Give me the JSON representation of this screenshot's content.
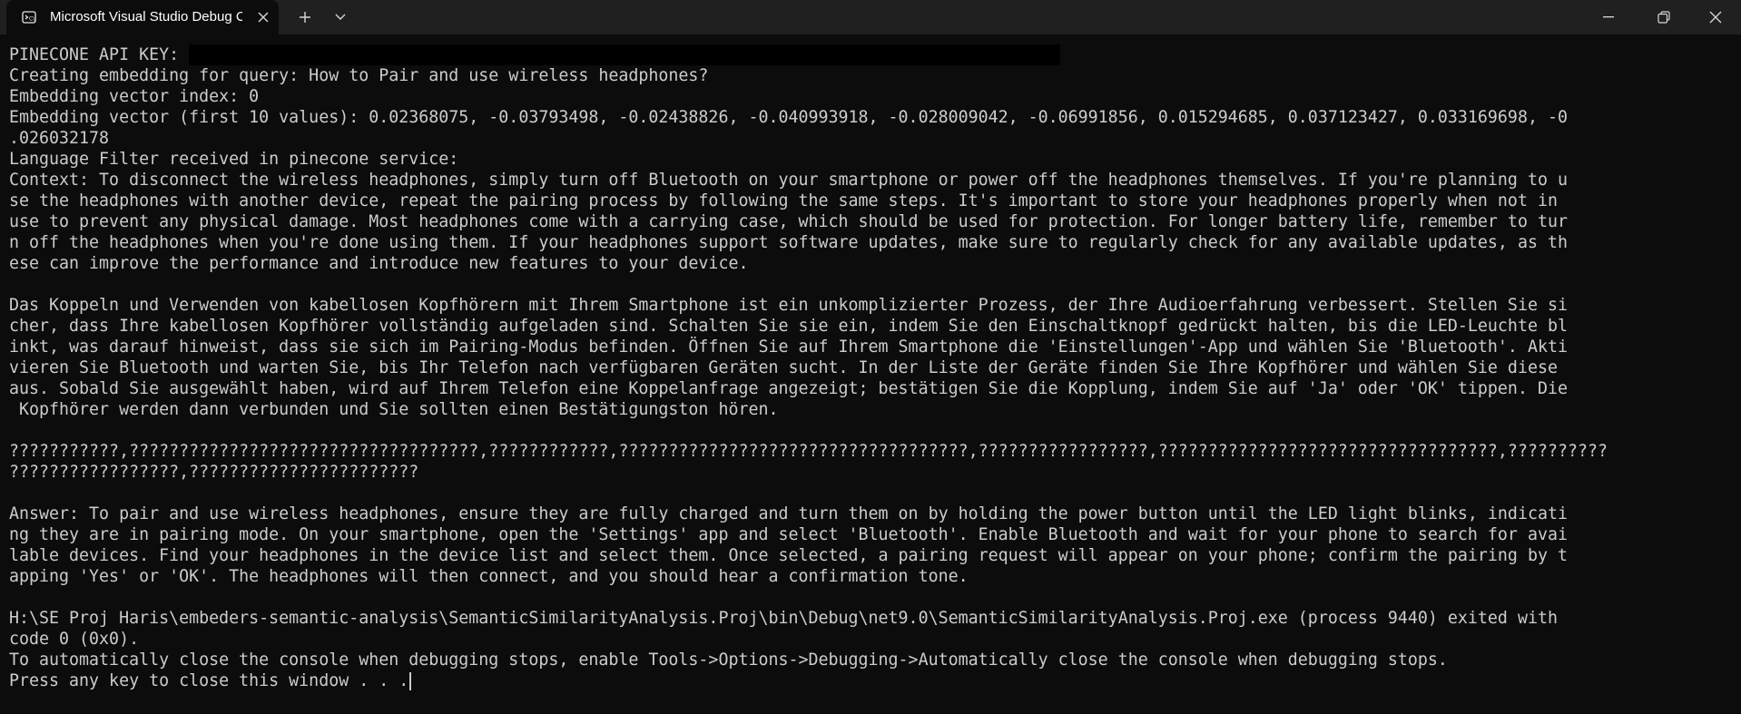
{
  "window": {
    "tab_title": "Microsoft Visual Studio Debug Console",
    "tab_icon": "console-icon",
    "close_tab_icon": "close-icon",
    "new_tab_icon": "plus-icon",
    "dropdown_icon": "chevron-down-icon",
    "minimize_icon": "minimize-icon",
    "maximize_icon": "restore-icon",
    "close_window_icon": "close-icon"
  },
  "console": {
    "lines": {
      "l01": "PINECONE API KEY: ",
      "l02": "Creating embedding for query: How to Pair and use wireless headphones?",
      "l03": "Embedding vector index: 0",
      "l04": "Embedding vector (first 10 values): 0.02368075, -0.03793498, -0.02438826, -0.040993918, -0.028009042, -0.06991856, 0.015294685, 0.037123427, 0.033169698, -0",
      "l05": ".026032178",
      "l06": "Language Filter received in pinecone service:",
      "l07": "Context: To disconnect the wireless headphones, simply turn off Bluetooth on your smartphone or power off the headphones themselves. If you're planning to u",
      "l08": "se the headphones with another device, repeat the pairing process by following the same steps. It's important to store your headphones properly when not in",
      "l09": "use to prevent any physical damage. Most headphones come with a carrying case, which should be used for protection. For longer battery life, remember to tur",
      "l10": "n off the headphones when you're done using them. If your headphones support software updates, make sure to regularly check for any available updates, as th",
      "l11": "ese can improve the performance and introduce new features to your device.",
      "l12": "",
      "l13": "Das Koppeln und Verwenden von kabellosen Kopfhörern mit Ihrem Smartphone ist ein unkomplizierter Prozess, der Ihre Audioerfahrung verbessert. Stellen Sie si",
      "l14": "cher, dass Ihre kabellosen Kopfhörer vollständig aufgeladen sind. Schalten Sie sie ein, indem Sie den Einschaltknopf gedrückt halten, bis die LED-Leuchte bl",
      "l15": "inkt, was darauf hinweist, dass sie sich im Pairing-Modus befinden. Öffnen Sie auf Ihrem Smartphone die 'Einstellungen'-App und wählen Sie 'Bluetooth'. Akti",
      "l16": "vieren Sie Bluetooth und warten Sie, bis Ihr Telefon nach verfügbaren Geräten sucht. In der Liste der Geräte finden Sie Ihre Kopfhörer und wählen Sie diese",
      "l17": "aus. Sobald Sie ausgewählt haben, wird auf Ihrem Telefon eine Koppelanfrage angezeigt; bestätigen Sie die Kopplung, indem Sie auf 'Ja' oder 'OK' tippen. Die",
      "l18": " Kopfhörer werden dann verbunden und Sie sollten einen Bestätigungston hören.",
      "l19": "",
      "l20": "???????????,???????????????????????????????????,????????????,???????????????????????????????????,?????????????????,??????????????????????????????????,??????????",
      "l21": "?????????????????,???????????????????????",
      "l22": "",
      "l23": "Answer: To pair and use wireless headphones, ensure they are fully charged and turn them on by holding the power button until the LED light blinks, indicati",
      "l24": "ng they are in pairing mode. On your smartphone, open the 'Settings' app and select 'Bluetooth'. Enable Bluetooth and wait for your phone to search for avai",
      "l25": "lable devices. Find your headphones in the device list and select them. Once selected, a pairing request will appear on your phone; confirm the pairing by t",
      "l26": "apping 'Yes' or 'OK'. The headphones will then connect, and you should hear a confirmation tone.",
      "l27": "",
      "l28": "H:\\SE Proj Haris\\embeders-semantic-analysis\\SemanticSimilarityAnalysis.Proj\\bin\\Debug\\net9.0\\SemanticSimilarityAnalysis.Proj.exe (process 9440) exited with",
      "l29": "code 0 (0x0).",
      "l30": "To automatically close the console when debugging stops, enable Tools->Options->Debugging->Automatically close the console when debugging stops.",
      "l31": "Press any key to close this window . . ."
    }
  },
  "colors": {
    "background": "#0c0c0c",
    "titlebar": "#202020",
    "text": "#cccccc"
  }
}
